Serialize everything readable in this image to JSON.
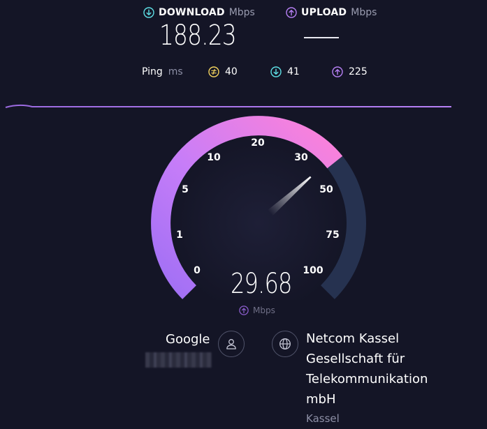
{
  "download": {
    "label": "DOWNLOAD",
    "unit": "Mbps",
    "value": "188.23"
  },
  "upload": {
    "label": "UPLOAD",
    "unit": "Mbps",
    "value": ""
  },
  "ping": {
    "label": "Ping",
    "unit": "ms",
    "idle": "40",
    "down": "41",
    "up": "225"
  },
  "gauge": {
    "current_value": "29.68",
    "unit": "Mbps",
    "scale": [
      "0",
      "1",
      "5",
      "10",
      "20",
      "30",
      "50",
      "75",
      "100"
    ],
    "fill_fraction": 0.69
  },
  "server": {
    "name": "Google"
  },
  "isp": {
    "name_lines": [
      "Netcom Kassel",
      "Gesellschaft für",
      "Telekommunikation",
      "mbH"
    ],
    "location": "Kassel"
  },
  "colors": {
    "background": "#141526",
    "download_accent": "#5ee0e6",
    "upload_accent": "#b780f5",
    "ping_accent": "#f4d35e",
    "gauge_start": "#b67cf7",
    "gauge_end": "#ff7fd9",
    "gauge_track": "#263250"
  },
  "icons": {
    "download": "arrow-down-circle-icon",
    "upload": "arrow-up-circle-icon",
    "ping_idle": "idle-latency-icon",
    "server": "user-icon",
    "isp": "globe-icon"
  }
}
